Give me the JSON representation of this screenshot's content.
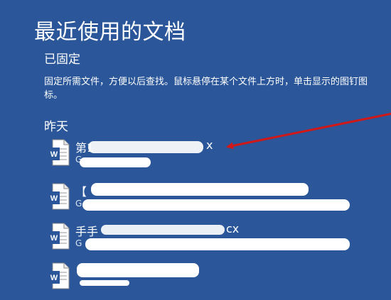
{
  "page": {
    "title": "最近使用的文档"
  },
  "pinned": {
    "heading": "已固定",
    "help": "固定所需文件，方便以后查找。鼠标悬停在某个文件上方时，单击显示的图钉图标。"
  },
  "yesterday": {
    "heading": "昨天",
    "documents": [
      {
        "name": "第1",
        "name_tail": "x",
        "path": "G",
        "icon": "word-doc-icon"
      },
      {
        "name": "【",
        "name_tail": "",
        "path": "G",
        "icon": "word-doc-icon"
      },
      {
        "name": "手手",
        "name_tail": "cx",
        "path": "G",
        "icon": "word-doc-icon"
      },
      {
        "name": "",
        "name_tail": "",
        "path": "",
        "icon": "word-doc-icon"
      }
    ]
  },
  "colors": {
    "background": "#2b579a",
    "text": "#ffffff",
    "arrow": "#d01818"
  }
}
